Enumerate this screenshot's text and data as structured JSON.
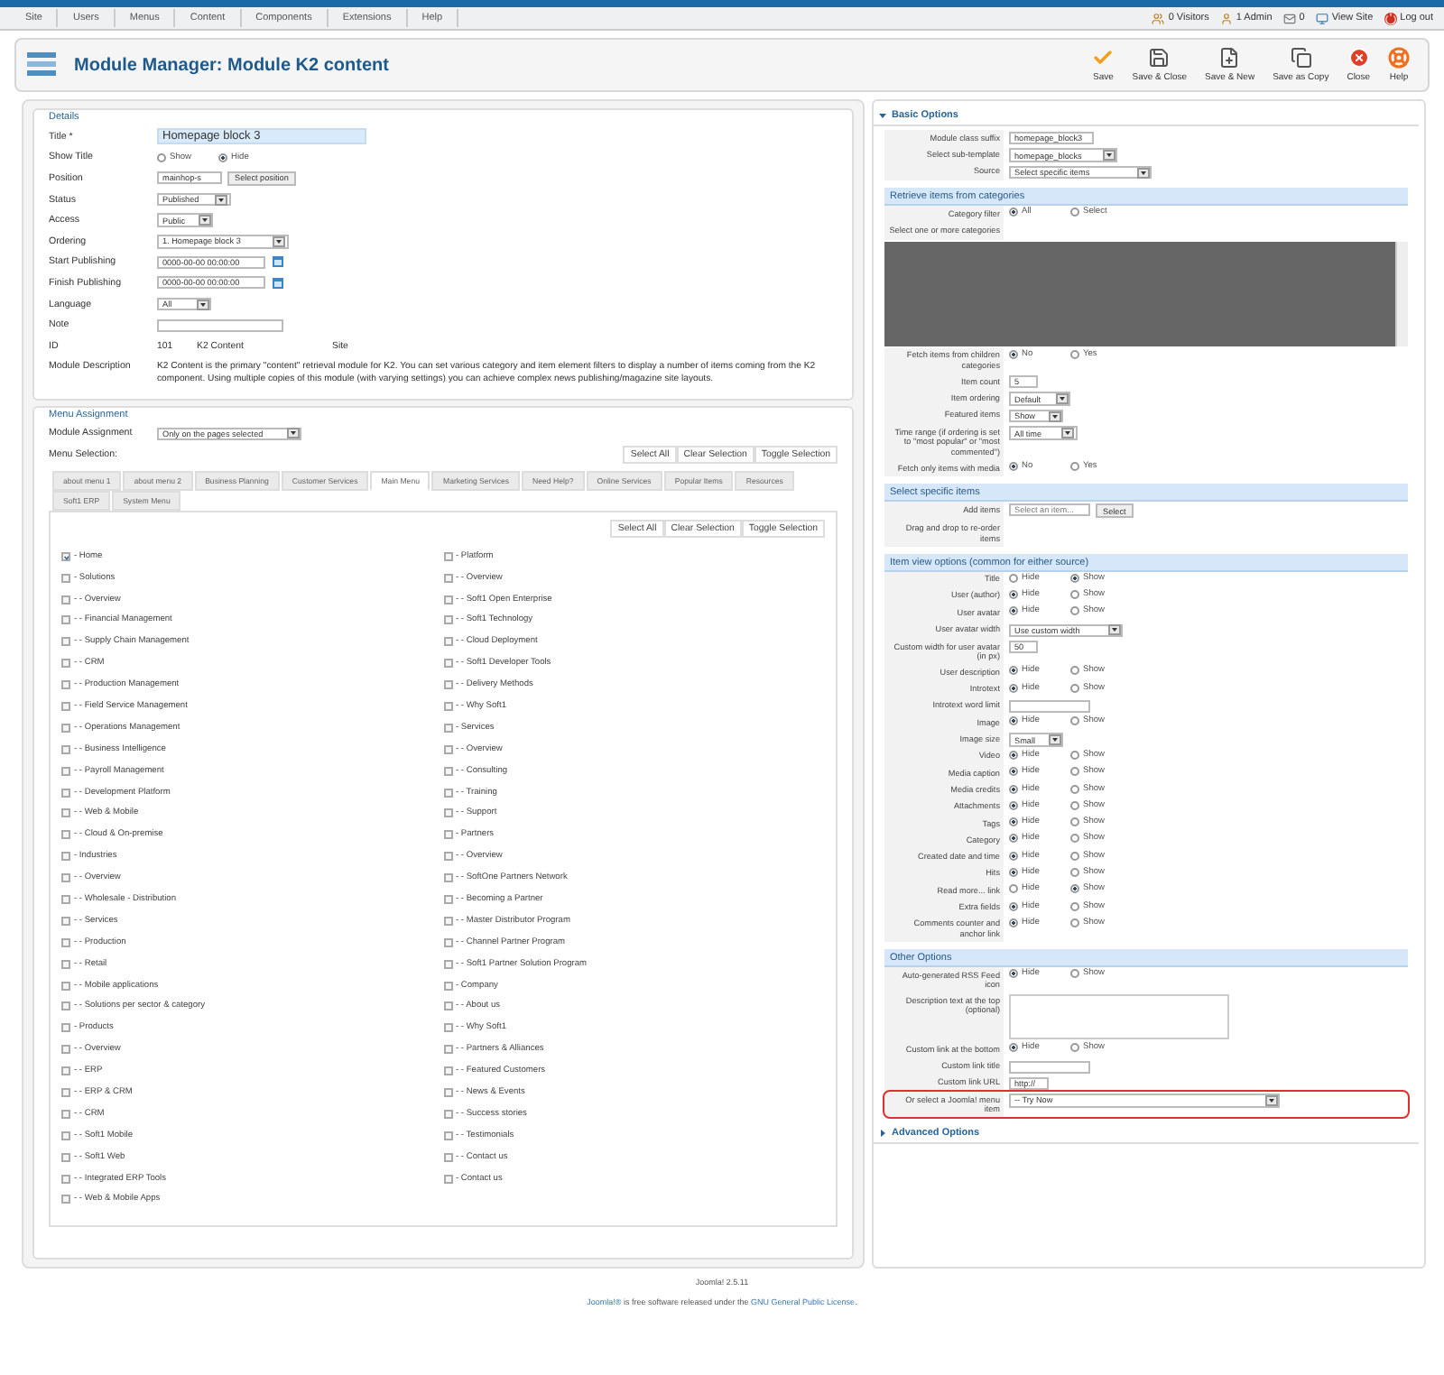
{
  "top_menu": [
    {
      "label": "Site"
    },
    {
      "label": "Users"
    },
    {
      "label": "Menus"
    },
    {
      "label": "Content"
    },
    {
      "label": "Components"
    },
    {
      "label": "Extensions"
    },
    {
      "label": "Help"
    }
  ],
  "status_items": [
    {
      "kind": "visitors",
      "text": "0 Visitors"
    },
    {
      "kind": "admin",
      "text": "1 Admin"
    },
    {
      "kind": "mail",
      "text": "0"
    },
    {
      "kind": "site",
      "text": "View Site"
    },
    {
      "kind": "logout",
      "text": "Log out"
    }
  ],
  "header": {
    "title": "Module Manager: Module K2 content",
    "toolbar": [
      {
        "kind": "save",
        "label": "Save"
      },
      {
        "kind": "save_close",
        "label": "Save & Close"
      },
      {
        "kind": "save_new",
        "label": "Save & New"
      },
      {
        "kind": "save_copy",
        "label": "Save as Copy"
      },
      {
        "kind": "close",
        "label": "Close"
      },
      {
        "kind": "help",
        "label": "Help"
      }
    ]
  },
  "details": {
    "legend": "Details",
    "fields": [
      {
        "label": "Title *",
        "kind": "title",
        "value": "Homepage block 3"
      },
      {
        "label": "Show Title",
        "kind": "radio",
        "options": [
          {
            "label": "Show",
            "selected": false
          },
          {
            "label": "Hide",
            "selected": true
          }
        ]
      },
      {
        "label": "Position",
        "kind": "text_button",
        "value": "mainhop-s",
        "button": "Select position"
      },
      {
        "label": "Status",
        "kind": "select",
        "value": "Published"
      },
      {
        "label": "Access",
        "kind": "select",
        "value": "Public"
      },
      {
        "label": "Ordering",
        "kind": "select",
        "value": "1. Homepage block 3"
      },
      {
        "label": "Start Publishing",
        "kind": "date",
        "value": "0000-00-00 00:00:00"
      },
      {
        "label": "Finish Publishing",
        "kind": "date",
        "value": "0000-00-00 00:00:00"
      },
      {
        "label": "Language",
        "kind": "select",
        "value": "All"
      },
      {
        "label": "Note",
        "kind": "text"
      },
      {
        "label": "ID",
        "kind": "info",
        "values": [
          "101",
          "K2 Content",
          "Site"
        ]
      },
      {
        "label": "Module Description",
        "kind": "description",
        "value": "K2 Content is the primary \"content\" retrieval module for K2. You can set various category and item element filters to display a number of items coming from the K2 component. Using multiple copies of this module (with varying settings) you can achieve complex news publishing/magazine site layouts."
      }
    ]
  },
  "menu_assignment": {
    "legend": "Menu Assignment",
    "assignment_label": "Module Assignment",
    "assignment_value": "Only on the pages selected",
    "selection_label": "Menu Selection:",
    "buttons": [
      "Select All",
      "Clear Selection",
      "Toggle Selection"
    ],
    "tabs": [
      {
        "label": "about menu 1",
        "selected": false
      },
      {
        "label": "about menu 2",
        "selected": false
      },
      {
        "label": "Business Planning",
        "selected": false
      },
      {
        "label": "Customer Services",
        "selected": false
      },
      {
        "label": "Main Menu",
        "selected": true
      },
      {
        "label": "Marketing Services",
        "selected": false
      },
      {
        "label": "Need Help?",
        "selected": false
      },
      {
        "label": "Online Services",
        "selected": false
      },
      {
        "label": "Popular Items",
        "selected": false
      },
      {
        "label": "Resources",
        "selected": false
      },
      {
        "label": "Soft1 ERP",
        "selected": false
      },
      {
        "label": "System Menu",
        "selected": false
      }
    ],
    "inner_buttons": [
      "Select All",
      "Clear Selection",
      "Toggle Selection"
    ],
    "columns": [
      {
        "items": [
          {
            "label": "- Home",
            "checked": true
          },
          {
            "label": "- Solutions",
            "checked": false
          },
          {
            "label": "- - Overview",
            "checked": false
          },
          {
            "label": "- - Financial Management",
            "checked": false
          },
          {
            "label": "- - Supply Chain Management",
            "checked": false
          },
          {
            "label": "- - CRM",
            "checked": false
          },
          {
            "label": "- - Production Management",
            "checked": false
          },
          {
            "label": "- - Field Service Management",
            "checked": false
          },
          {
            "label": "- - Operations Management",
            "checked": false
          },
          {
            "label": "- - Business Intelligence",
            "checked": false
          },
          {
            "label": "- - Payroll Management",
            "checked": false
          },
          {
            "label": "- - Development Platform",
            "checked": false
          },
          {
            "label": "- - Web & Mobile",
            "checked": false
          },
          {
            "label": "- - Cloud & On-premise",
            "checked": false
          },
          {
            "label": "- Industries",
            "checked": false
          },
          {
            "label": "- - Overview",
            "checked": false
          },
          {
            "label": "- - Wholesale - Distribution",
            "checked": false
          },
          {
            "label": "- - Services",
            "checked": false
          },
          {
            "label": "- - Production",
            "checked": false
          },
          {
            "label": "- - Retail",
            "checked": false
          },
          {
            "label": "- - Mobile applications",
            "checked": false
          },
          {
            "label": "- - Solutions per sector & category",
            "checked": false
          },
          {
            "label": "- Products",
            "checked": false
          },
          {
            "label": "- - Overview",
            "checked": false
          },
          {
            "label": "- - ERP",
            "checked": false
          },
          {
            "label": "- - ERP & CRM",
            "checked": false
          },
          {
            "label": "- - CRM",
            "checked": false
          },
          {
            "label": "- - Soft1 Mobile",
            "checked": false
          },
          {
            "label": "- - Soft1 Web",
            "checked": false
          },
          {
            "label": "- - Integrated ERP Tools",
            "checked": false
          },
          {
            "label": "- - Web & Mobile Apps",
            "checked": false
          }
        ]
      },
      {
        "items": [
          {
            "label": "- Platform",
            "checked": false
          },
          {
            "label": "- - Overview",
            "checked": false
          },
          {
            "label": "- - Soft1 Open Enterprise",
            "checked": false
          },
          {
            "label": "- - Soft1 Technology",
            "checked": false
          },
          {
            "label": "- - Cloud Deployment",
            "checked": false
          },
          {
            "label": "- - Soft1 Developer Tools",
            "checked": false
          },
          {
            "label": "- - Delivery Methods",
            "checked": false
          },
          {
            "label": "- - Why Soft1",
            "checked": false
          },
          {
            "label": "- Services",
            "checked": false
          },
          {
            "label": "- - Overview",
            "checked": false
          },
          {
            "label": "- - Consulting",
            "checked": false
          },
          {
            "label": "- - Training",
            "checked": false
          },
          {
            "label": "- - Support",
            "checked": false
          },
          {
            "label": "- Partners",
            "checked": false
          },
          {
            "label": "- - Overview",
            "checked": false
          },
          {
            "label": "- - SoftOne Partners Network",
            "checked": false
          },
          {
            "label": "- - Becoming a Partner",
            "checked": false
          },
          {
            "label": "- - Master Distributor Program",
            "checked": false
          },
          {
            "label": "- - Channel Partner Program",
            "checked": false
          },
          {
            "label": "- - Soft1 Partner Solution Program",
            "checked": false
          },
          {
            "label": "- Company",
            "checked": false
          },
          {
            "label": "- - About us",
            "checked": false
          },
          {
            "label": "- - Why Soft1",
            "checked": false
          },
          {
            "label": "- - Partners & Alliances",
            "checked": false
          },
          {
            "label": "- - Featured Customers",
            "checked": false
          },
          {
            "label": "- - News & Events",
            "checked": false
          },
          {
            "label": "- - Success stories",
            "checked": false
          },
          {
            "label": "- - Testimonials",
            "checked": false
          },
          {
            "label": "- - Contact us",
            "checked": false
          },
          {
            "label": "- Contact us",
            "checked": false
          }
        ]
      }
    ]
  },
  "options": [
    {
      "title": "Basic Options",
      "expanded": true,
      "rows": [
        {
          "label": "Module class suffix",
          "kind": "text",
          "value": "homepage_block3"
        },
        {
          "label": "Select sub-template",
          "kind": "select",
          "value": "homepage_blocks"
        },
        {
          "label": "Source",
          "kind": "select",
          "value": "Select specific items"
        }
      ],
      "groups": [
        {
          "title": "Retrieve items from categories",
          "rows": [
            {
              "label": "Category filter",
              "kind": "radio",
              "options": [
                {
                  "label": "All",
                  "selected": true
                },
                {
                  "label": "Select",
                  "selected": false
                }
              ]
            },
            {
              "label": "Select one or more categories",
              "kind": "label"
            },
            {
              "kind": "listbox"
            },
            {
              "label": "Fetch items from children categories",
              "kind": "radio",
              "options": [
                {
                  "label": "No",
                  "selected": true
                },
                {
                  "label": "Yes",
                  "selected": false
                }
              ]
            },
            {
              "label": "Item count",
              "kind": "text",
              "value": "5"
            },
            {
              "label": "Item ordering",
              "kind": "select",
              "value": "Default"
            },
            {
              "label": "Featured items",
              "kind": "select",
              "value": "Show"
            },
            {
              "label": "Time range (if ordering is set to \"most popular\" or \"most commented\")",
              "kind": "select",
              "value": "All time"
            },
            {
              "label": "Fetch only items with media",
              "kind": "radio",
              "options": [
                {
                  "label": "No",
                  "selected": true
                },
                {
                  "label": "Yes",
                  "selected": false
                }
              ]
            }
          ]
        },
        {
          "title": "Select specific items",
          "rows": [
            {
              "label": "Add items",
              "kind": "text_button",
              "placeholder": "Select an item...",
              "button": "Select"
            },
            {
              "label": "Drag and drop to re-order items",
              "kind": "label"
            }
          ]
        },
        {
          "title": "Item view options (common for either source)",
          "rows": [
            {
              "label": "Title",
              "kind": "radio",
              "options": [
                {
                  "label": "Hide",
                  "selected": false
                },
                {
                  "label": "Show",
                  "selected": true
                }
              ]
            },
            {
              "label": "User (author)",
              "kind": "radio",
              "options": [
                {
                  "label": "Hide",
                  "selected": true
                },
                {
                  "label": "Show",
                  "selected": false
                }
              ]
            },
            {
              "label": "User avatar",
              "kind": "radio",
              "options": [
                {
                  "label": "Hide",
                  "selected": true
                },
                {
                  "label": "Show",
                  "selected": false
                }
              ]
            },
            {
              "label": "User avatar width",
              "kind": "select",
              "value": "Use custom width"
            },
            {
              "label": "Custom width for user avatar (in px)",
              "kind": "text",
              "value": "50"
            },
            {
              "label": "User description",
              "kind": "radio",
              "options": [
                {
                  "label": "Hide",
                  "selected": true
                },
                {
                  "label": "Show",
                  "selected": false
                }
              ]
            },
            {
              "label": "Introtext",
              "kind": "radio",
              "options": [
                {
                  "label": "Hide",
                  "selected": true
                },
                {
                  "label": "Show",
                  "selected": false
                }
              ]
            },
            {
              "label": "Introtext word limit",
              "kind": "text"
            },
            {
              "label": "Image",
              "kind": "radio",
              "options": [
                {
                  "label": "Hide",
                  "selected": true
                },
                {
                  "label": "Show",
                  "selected": false
                }
              ]
            },
            {
              "label": "Image size",
              "kind": "select",
              "value": "Small"
            },
            {
              "label": "Video",
              "kind": "radio",
              "options": [
                {
                  "label": "Hide",
                  "selected": true
                },
                {
                  "label": "Show",
                  "selected": false
                }
              ]
            },
            {
              "label": "Media caption",
              "kind": "radio",
              "options": [
                {
                  "label": "Hide",
                  "selected": true
                },
                {
                  "label": "Show",
                  "selected": false
                }
              ]
            },
            {
              "label": "Media credits",
              "kind": "radio",
              "options": [
                {
                  "label": "Hide",
                  "selected": true
                },
                {
                  "label": "Show",
                  "selected": false
                }
              ]
            },
            {
              "label": "Attachments",
              "kind": "radio",
              "options": [
                {
                  "label": "Hide",
                  "selected": true
                },
                {
                  "label": "Show",
                  "selected": false
                }
              ]
            },
            {
              "label": "Tags",
              "kind": "radio",
              "options": [
                {
                  "label": "Hide",
                  "selected": true
                },
                {
                  "label": "Show",
                  "selected": false
                }
              ]
            },
            {
              "label": "Category",
              "kind": "radio",
              "options": [
                {
                  "label": "Hide",
                  "selected": true
                },
                {
                  "label": "Show",
                  "selected": false
                }
              ]
            },
            {
              "label": "Created date and time",
              "kind": "radio",
              "options": [
                {
                  "label": "Hide",
                  "selected": true
                },
                {
                  "label": "Show",
                  "selected": false
                }
              ]
            },
            {
              "label": "Hits",
              "kind": "radio",
              "options": [
                {
                  "label": "Hide",
                  "selected": true
                },
                {
                  "label": "Show",
                  "selected": false
                }
              ]
            },
            {
              "label": "Read more... link",
              "kind": "radio",
              "options": [
                {
                  "label": "Hide",
                  "selected": false
                },
                {
                  "label": "Show",
                  "selected": true
                }
              ]
            },
            {
              "label": "Extra fields",
              "kind": "radio",
              "options": [
                {
                  "label": "Hide",
                  "selected": true
                },
                {
                  "label": "Show",
                  "selected": false
                }
              ]
            },
            {
              "label": "Comments counter and anchor link",
              "kind": "radio",
              "options": [
                {
                  "label": "Hide",
                  "selected": true
                },
                {
                  "label": "Show",
                  "selected": false
                }
              ]
            }
          ]
        },
        {
          "title": "Other Options",
          "rows": [
            {
              "label": "Auto-generated RSS Feed icon",
              "kind": "radio",
              "options": [
                {
                  "label": "Hide",
                  "selected": true
                },
                {
                  "label": "Show",
                  "selected": false
                }
              ]
            },
            {
              "label": "Description text at the top (optional)",
              "kind": "textarea"
            },
            {
              "label": "Custom link at the bottom",
              "kind": "radio",
              "options": [
                {
                  "label": "Hide",
                  "selected": true
                },
                {
                  "label": "Show",
                  "selected": false
                }
              ]
            },
            {
              "label": "Custom link title",
              "kind": "text"
            },
            {
              "label": "Custom link URL",
              "kind": "text",
              "value": "http://"
            },
            {
              "label": "Or select a Joomla! menu item",
              "kind": "select",
              "value": "-- Try Now",
              "highlighted": true
            }
          ]
        }
      ]
    },
    {
      "title": "Advanced Options",
      "expanded": false
    }
  ],
  "footer": {
    "version": "Joomla! 2.5.11",
    "license": [
      {
        "text": "Joomla!®",
        "link": true
      },
      {
        "text": " is free software released under the ",
        "link": false
      },
      {
        "text": "GNU General Public License",
        "link": true
      },
      {
        "text": ".",
        "link": false
      }
    ]
  }
}
